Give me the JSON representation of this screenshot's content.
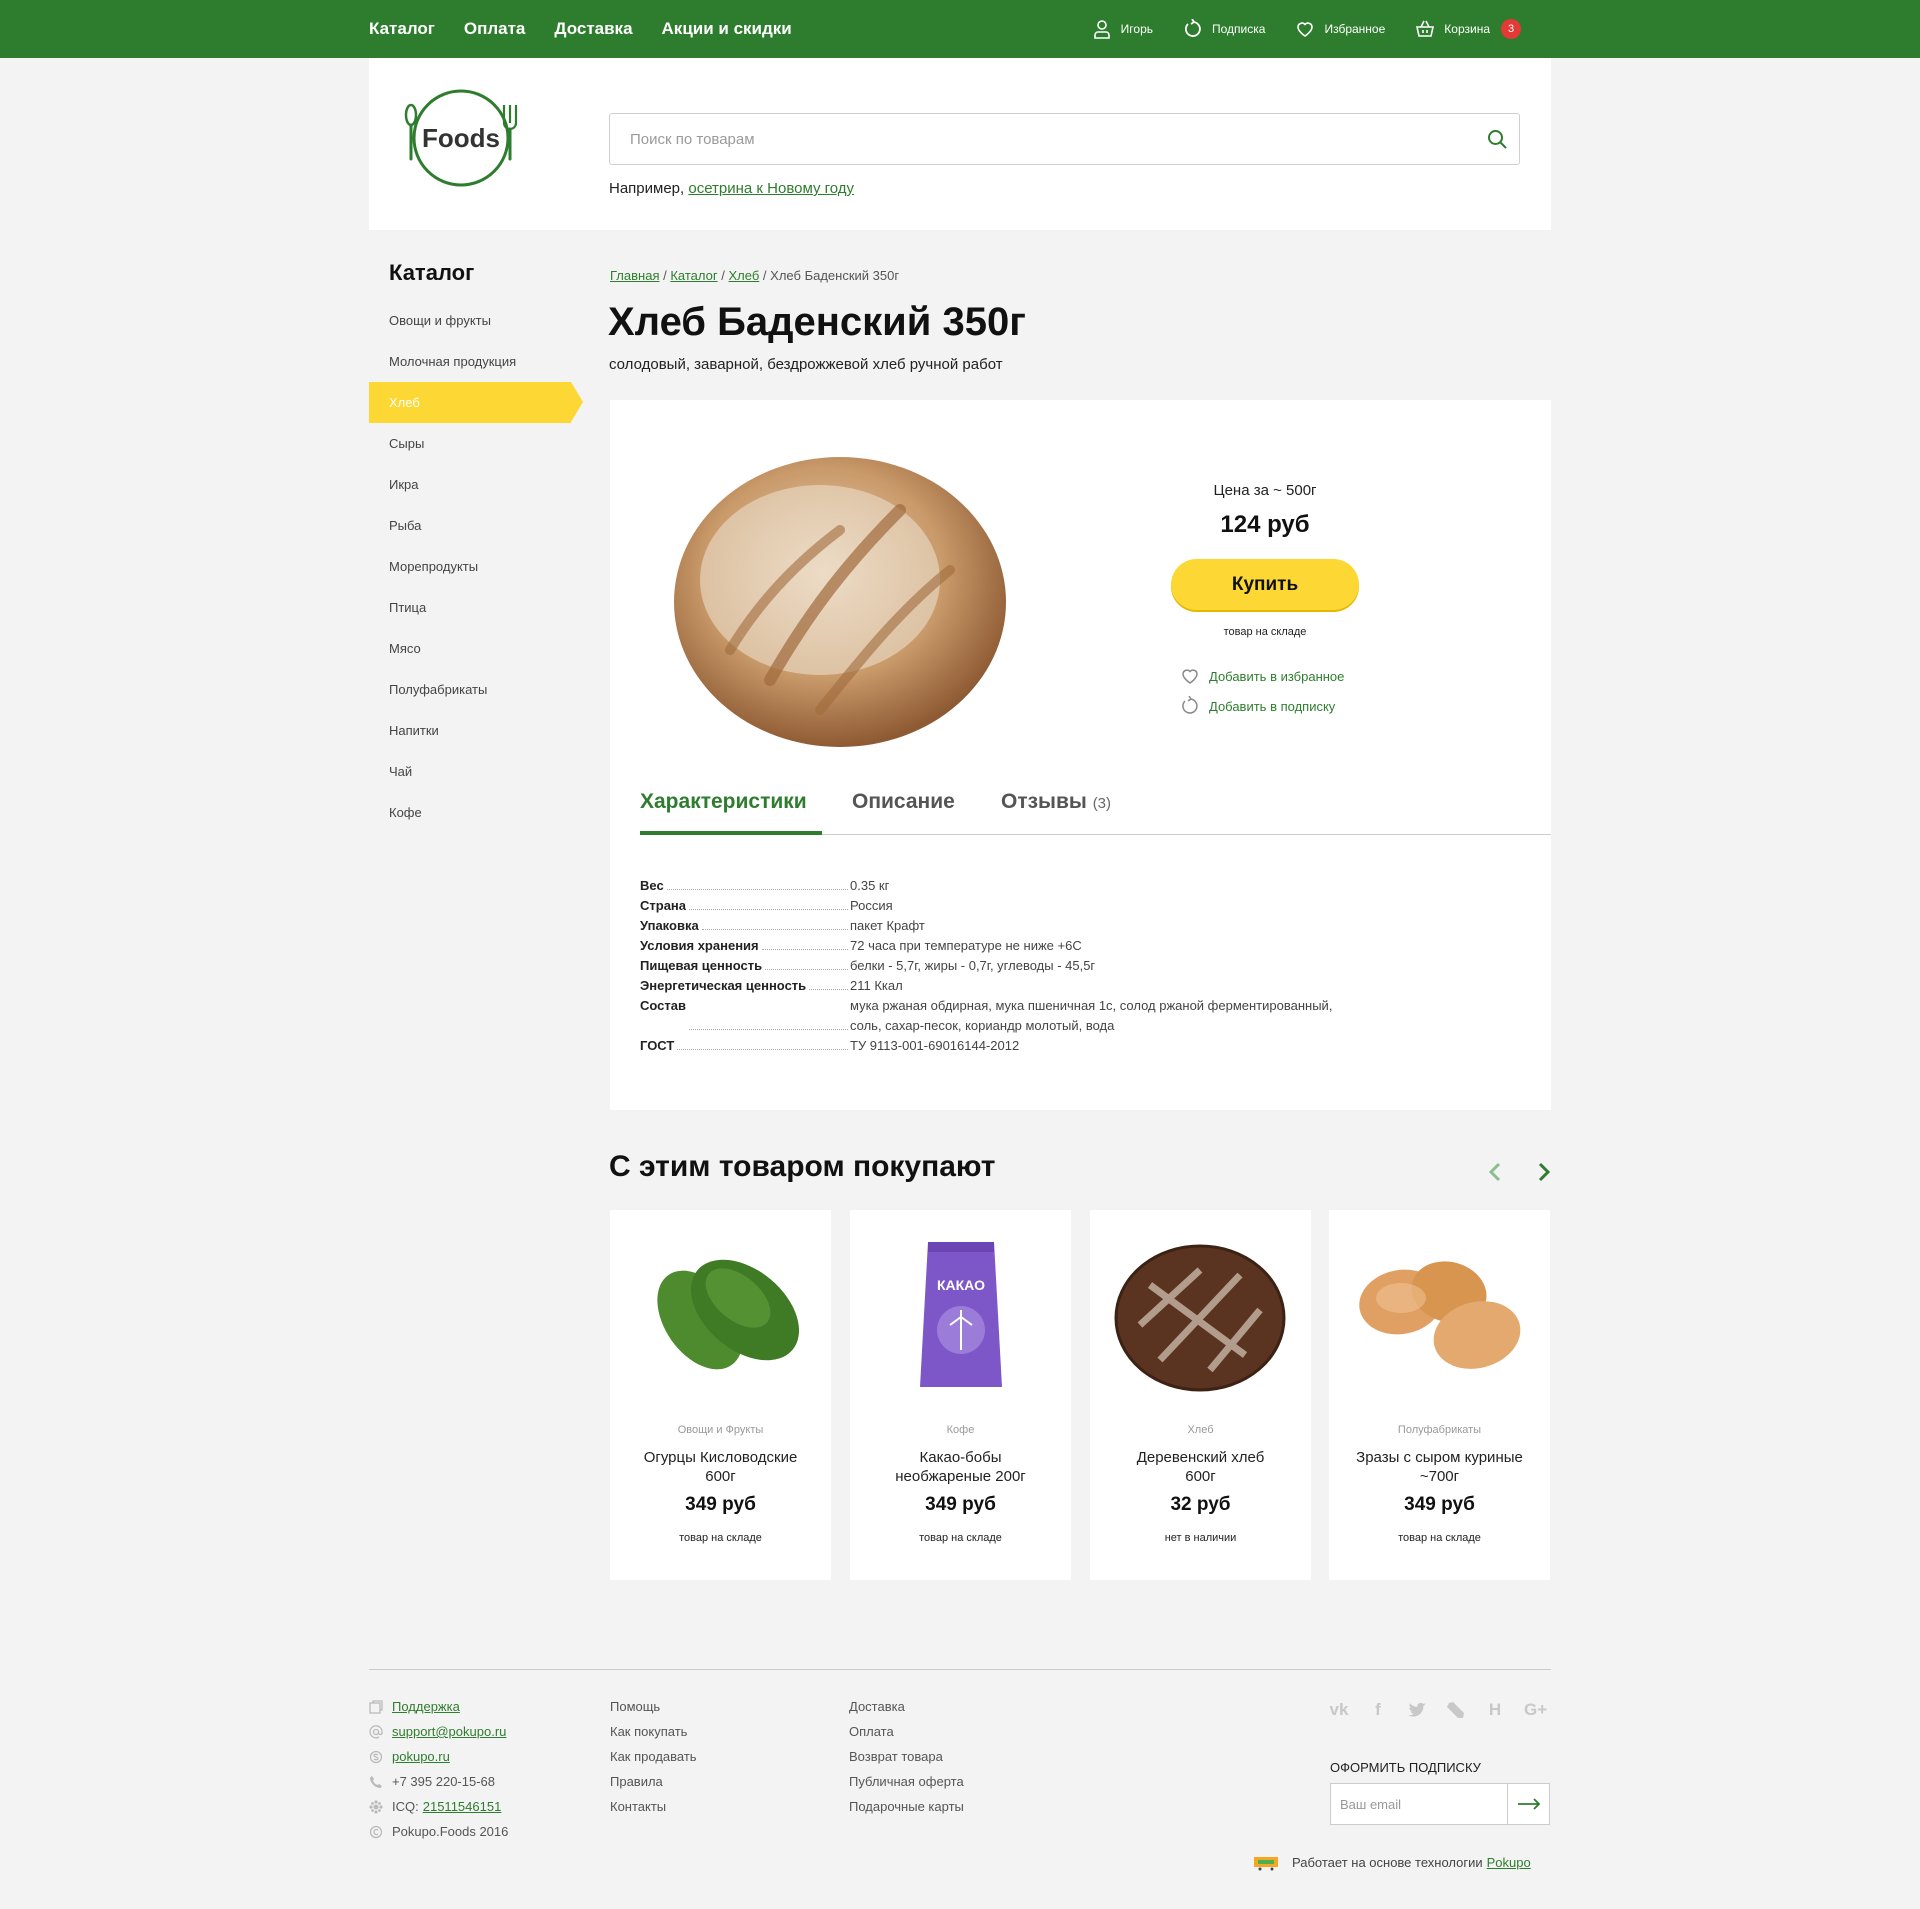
{
  "topnav": {
    "items": [
      "Каталог",
      "Оплата",
      "Доставка",
      "Акции и скидки"
    ]
  },
  "userbar": {
    "user": "Игорь",
    "subscription": "Подписка",
    "favorites": "Избранное",
    "cart": "Корзина",
    "cart_count": "3"
  },
  "header": {
    "logo_text": "Foods",
    "search_placeholder": "Поиск по товарам",
    "example_prefix": "Например,",
    "example_link": "осетрина к Новому году"
  },
  "colors": {
    "brand_green": "#2e7d2e",
    "accent_yellow": "#fdd835",
    "badge_red": "#e53935"
  },
  "sidebar": {
    "title": "Каталог",
    "items": [
      "Овощи и фрукты",
      "Молочная продукция",
      "Хлеб",
      "Сыры",
      "Икра",
      "Рыба",
      "Морепродукты",
      "Птица",
      "Мясо",
      "Полуфабрикаты",
      "Напитки",
      "Чай",
      "Кофе"
    ],
    "active": "Хлеб"
  },
  "breadcrumb": {
    "home": "Главная",
    "catalog": "Каталог",
    "category": "Хлеб",
    "current": "Хлеб Баденский 350г",
    "sep": "/"
  },
  "product": {
    "title": "Хлеб Баденский 350г",
    "subtitle": "солодовый, заварной, бездрожжевой хлеб ручной работ",
    "price_caption": "Цена за ~ 500г",
    "price": "124 руб",
    "buy_label": "Купить",
    "stock": "товар на складе",
    "add_favorite": "Добавить в избранное",
    "add_subscription": "Добавить в подписку"
  },
  "tabs": {
    "specs": "Характеристики",
    "description": "Описание",
    "reviews": "Отзывы",
    "reviews_count": "(3)"
  },
  "specs": [
    {
      "key": "Вес",
      "value": "0.35 кг"
    },
    {
      "key": "Страна",
      "value": "Россия"
    },
    {
      "key": "Упаковка",
      "value": "пакет Крафт"
    },
    {
      "key": "Условия хранения",
      "value": "72 часа при температуре не ниже +6С"
    },
    {
      "key": "Пищевая ценность",
      "value": "белки - 5,7г, жиры - 0,7г, углеводы - 45,5г"
    },
    {
      "key": "Энергетическая ценность",
      "value": "211 Ккал"
    },
    {
      "key": "Состав",
      "value": "мука ржаная обдирная, мука пшеничная 1с, солод ржаной ферментированный,",
      "value2": "соль, сахар-песок, кориандр молотый, вода"
    },
    {
      "key": "ГОСТ",
      "value": "ТУ 9113-001-69016144-2012"
    }
  ],
  "related": {
    "title": "С этим товаром покупают",
    "items": [
      {
        "category": "Овощи и Фрукты",
        "name_line1": "Огурцы Кисловодские",
        "name_line2": "600г",
        "price": "349 руб",
        "stock": "товар на складе"
      },
      {
        "category": "Кофе",
        "name_line1": "Какао-бобы",
        "name_line2": "необжареные 200г",
        "price": "349 руб",
        "stock": "товар на складе",
        "pack_label": "КАКАО"
      },
      {
        "category": "Хлеб",
        "name_line1": "Деревенский хлеб",
        "name_line2": "600г",
        "price": "32 руб",
        "stock": "нет в наличии"
      },
      {
        "category": "Полуфабрикаты",
        "name_line1": "Зразы с сыром куриные",
        "name_line2": "~700г",
        "price": "349 руб",
        "stock": "товар на складе"
      }
    ]
  },
  "footer": {
    "contacts": {
      "support": "Поддержка",
      "email": "support@pokupo.ru",
      "skype": "pokupo.ru",
      "phone": "+7 395 220-15-68",
      "icq_label": "ICQ:",
      "icq": "21511546151",
      "copyright": "Pokupo.Foods 2016"
    },
    "col2": [
      "Помощь",
      "Как покупать",
      "Как продавать",
      "Правила",
      "Контакты"
    ],
    "col3": [
      "Доставка",
      "Оплата",
      "Возврат товара",
      "Публичная оферта",
      "Подарочные карты"
    ],
    "subscribe_title": "ОФОРМИТЬ ПОДПИСКУ",
    "email_placeholder": "Ваш email",
    "powered_text": "Работает на основе технологии",
    "powered_link": "Pokupo"
  },
  "social_icons": [
    "vk-icon",
    "facebook-icon",
    "twitter-icon",
    "livejournal-icon",
    "habr-icon",
    "google-plus-icon"
  ]
}
